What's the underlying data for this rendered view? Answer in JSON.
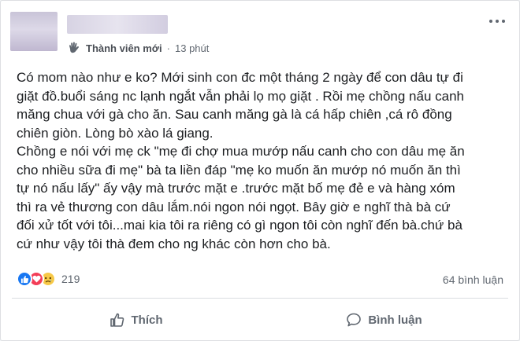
{
  "post": {
    "member_badge": "Thành viên mới",
    "separator": "·",
    "time": "13 phút",
    "lines": [
      "Có mom nào như e ko? Mới sinh con đc một tháng 2 ngày để con dâu tự đi",
      "giặt đồ.buổi sáng nc lạnh ngắt vẫn phải lọ mọ giặt . Rồi mẹ chồng nấu canh",
      "măng chua với gà cho ăn. Sau canh măng gà là cá hấp chiên ,cá rô đồng",
      "chiên giòn. Lòng bò xào lá giang.",
      "Chồng e nói với mẹ ck \"mẹ đi chợ mua mướp nấu canh cho con dâu mẹ ăn",
      "cho nhiều sữa đi mẹ\" bà ta liền đáp \"mẹ ko muốn ăn mướp nó muốn ăn thì",
      "tự nó nấu lấy\" ấy vậy mà trước mặt e .trước mặt bố mẹ đẻ e và hàng xóm",
      "thì ra vẻ thương con dâu lắm.nói ngon nói ngọt. Bây giờ e nghĩ thà bà cứ",
      "đối xử tốt với tôi...mai kia tôi ra riêng có gì ngon tôi còn nghĩ đến bà.chứ bà",
      "cứ như vậy tôi thà đem cho ng khác còn hơn cho bà."
    ]
  },
  "stats": {
    "reaction_icons": [
      "like-icon",
      "love-icon",
      "sad-icon"
    ],
    "reaction_count": "219",
    "comments_count": "64 bình luận"
  },
  "actions": {
    "like_label": "Thích",
    "comment_label": "Bình luận"
  },
  "colors": {
    "like": "#1877f2",
    "love": "#f33e58",
    "sad": "#f7c948",
    "muted_text": "#606770"
  }
}
